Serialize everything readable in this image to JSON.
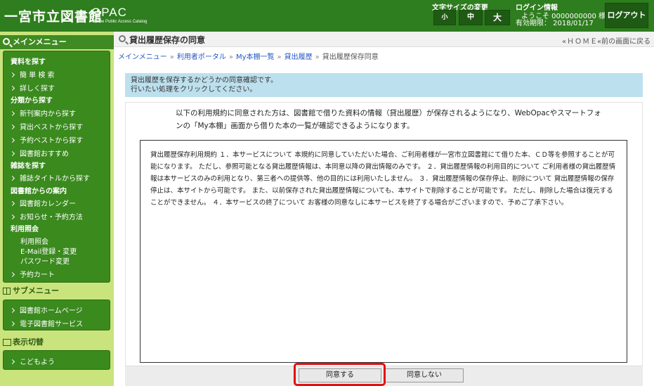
{
  "header": {
    "library_name": "一宮市立図書館",
    "opac": "OPAC",
    "opac_sub": "Online Public Access Catalog",
    "font_size_label": "文字サイズの変更",
    "font_small": "小",
    "font_medium": "中",
    "font_large": "大",
    "login_title": "ログイン情報",
    "welcome": "ようこそ 0000000000 様",
    "valid_until": "有効期限： 2018/01/17",
    "logout": "ログアウト"
  },
  "sidebar": {
    "main_menu": "メインメニュー",
    "sections": {
      "search": "資料を探す",
      "simple_search": "簡 単 検 索",
      "detail_search": "詳しく探す",
      "category": "分類から探す",
      "new_arrivals": "新刊案内から探す",
      "loan_best": "貸出ベストから探す",
      "reserve_best": "予約ベストから探す",
      "recommend": "図書館おすすめ",
      "magazine": "雑誌を探す",
      "magazine_title": "雑誌タイトルから探す",
      "guide": "図書館からの案内",
      "calendar": "図書館カレンダー",
      "news": "お知らせ・予約方法",
      "inquiry": "利用照会",
      "inquiry_item": "利用照会",
      "email": "E-Mail登録・変更",
      "password": "パスワード変更",
      "reserve_cart": "予約カート"
    },
    "sub_menu": "サブメニュー",
    "sub_items": {
      "homepage": "図書館ホームページ",
      "e_library": "電子図書館サービス"
    },
    "display_switch": "表示切替",
    "kids": "こどもよう"
  },
  "main": {
    "title": "貸出履歴保存の同意",
    "nav_home": "«ＨＯＭＥ",
    "nav_back": "«前の画面に戻る",
    "breadcrumb": [
      "メインメニュー",
      "利用者ポータル",
      "My本棚一覧",
      "貸出履歴",
      "貸出履歴保存同意"
    ],
    "info_line1": "貸出履歴を保存するかどうかの同意確認です。",
    "info_line2": "行いたい処理をクリックしてください。",
    "intro": "以下の利用規約に同意された方は、図書館で借りた資料の情報（貸出履歴）が保存されるようになり、WebOpacやスマートフォンの「My本棚」画面から借りた本の一覧が確認できるようになります。",
    "terms": "貸出履歴保存利用規約 １．本サービスについて 本規約に同意していただいた場合、ご利用者様が一宮市立図書館にて借りた本、ＣＤ等を参照することが可能になります。 ただし、参照可能となる貸出履歴情報は、本同意以降の貸出情報のみです。 ２．貸出履歴情報の利用目的について ご利用者様の貸出履歴情報は本サービスのみの利用となり、第三者への提供等、他の目的には利用いたしません。 ３．貸出履歴情報の保存停止、削除について 貸出履歴情報の保存停止は、本サイトから可能です。 また、以前保存された貸出履歴情報についても、本サイトで削除することが可能です。 ただし、削除した場合は復元することができません。 ４．本サービスの終了について お客様の同意なしに本サービスを終了する場合がございますので、予めご了承下さい。",
    "agree": "同意する",
    "disagree": "同意しない"
  }
}
